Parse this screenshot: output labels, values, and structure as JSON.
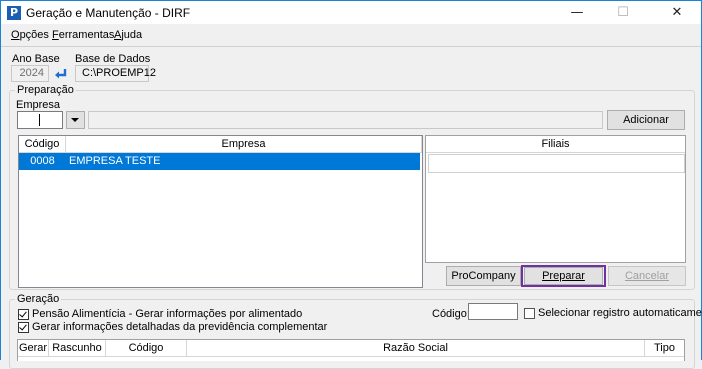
{
  "window": {
    "title": "Geração e Manutenção - DIRF",
    "minimize_glyph": "—",
    "maximize_glyph": "☐",
    "close_glyph": "✕",
    "app_icon_letter": "P",
    "app_icon_color": "#1a5fb4"
  },
  "menu": [
    {
      "accel": "O",
      "rest": "pções"
    },
    {
      "accel": "F",
      "rest": "erramentas"
    },
    {
      "accel": "A",
      "rest": "juda"
    }
  ],
  "header": {
    "ano_base_label": "Ano Base",
    "ano_base_value": "2024",
    "base_dados_label": "Base de Dados",
    "base_dados_value": "C:\\PROEMP12"
  },
  "preparacao": {
    "legend": "Preparação",
    "empresa_label": "Empresa",
    "empresa_value": "",
    "empresa_name": "",
    "add_button": "Adicionar",
    "grid_columns": [
      "Código",
      "Empresa"
    ],
    "rows": [
      {
        "codigo": "0008",
        "empresa": "EMPRESA TESTE",
        "selected": true
      }
    ],
    "filiais_header": "Filiais",
    "procompany_button": "ProCompany",
    "preparar_button": "Preparar",
    "cancelar_button": "Cancelar",
    "highlight_color": "#7030a0",
    "selection_color": "#0078d7"
  },
  "geracao": {
    "legend": "Geração",
    "pensao_label": "Pensão Alimentícia - Gerar informações por alimentado",
    "pensao_checked": true,
    "previdencia_label": "Gerar informações detalhadas da previdência complementar",
    "previdencia_checked": true,
    "codigo_label": "Código:",
    "codigo_value": "",
    "auto_select_label": "Selecionar registro automaticamente",
    "auto_select_checked": false,
    "columns": [
      "Gerar",
      "Rascunho",
      "Código",
      "Razão Social",
      "Tipo"
    ]
  }
}
